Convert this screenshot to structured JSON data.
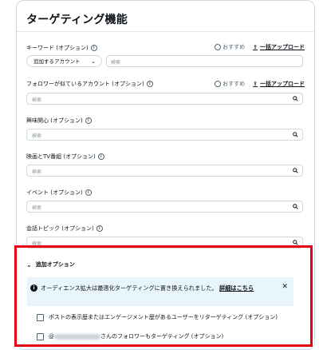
{
  "section_title": "ターゲティング機能",
  "links": {
    "recommend": "おすすめ",
    "bulk_upload": "一括アップロード"
  },
  "keyword": {
    "label": "キーワード (オプション)",
    "account_select": "追加するアカウント",
    "placeholder": "検索"
  },
  "follower_lookalike": {
    "label": "フォロワーが似ているアカウント (オプション)",
    "placeholder": "検索"
  },
  "interests": {
    "label": "興味関心 (オプション)",
    "placeholder": "検索"
  },
  "movies_tv": {
    "label": "映画とTV番組 (オプション)",
    "placeholder": "検索"
  },
  "events": {
    "label": "イベント (オプション)",
    "placeholder": "検索"
  },
  "conversation_topics": {
    "label": "会話トピック (オプション)",
    "placeholder": "検索"
  },
  "additional_options": {
    "label": "追加オプション",
    "notice": "オーディエンス拡大は最適化ターゲティングに置き換えられました。",
    "notice_more": "詳細はこちら",
    "checkbox_retarget": "ポストの表示歴またはエンゲージメント歴があるユーザーをリターゲティング (オプション)",
    "checkbox_followers_prefix": "@",
    "checkbox_followers_suffix": "さんのフォロワーもターゲティング (オプション)"
  },
  "colors": {
    "highlight": "#e60012",
    "notice_bg": "#e8f5fd"
  }
}
